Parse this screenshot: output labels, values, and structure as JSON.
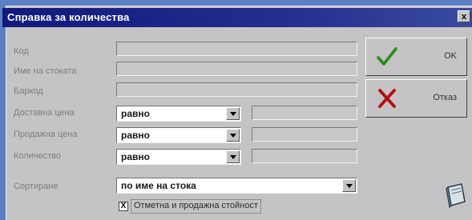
{
  "dialog": {
    "title": "Справка за количества",
    "close_label": "x"
  },
  "fields": {
    "code_label": "Код",
    "name_label": "Име на стоката",
    "barcode_label": "Баркод",
    "delivery_price_label": "Доставна цена",
    "sale_price_label": "Продажна цена",
    "quantity_label": "Количество",
    "sort_label": "Сортиране"
  },
  "combos": {
    "delivery_operator": "равно",
    "sale_operator": "равно",
    "quantity_operator": "равно",
    "sort_value": "по име на стока"
  },
  "buttons": {
    "ok_label": "OK",
    "cancel_label": "Отказ"
  },
  "checkbox": {
    "label": "Отметна и продажна стойност",
    "checked_mark": "X"
  },
  "icons": {
    "ok_icon": "checkmark-icon",
    "cancel_icon": "cross-icon",
    "book_icon": "book-icon"
  },
  "colors": {
    "titlebar": "#101a7e",
    "dialog_bg": "#c6c3c6",
    "ok_green": "#3aa12a",
    "cancel_red": "#c81a1a"
  }
}
